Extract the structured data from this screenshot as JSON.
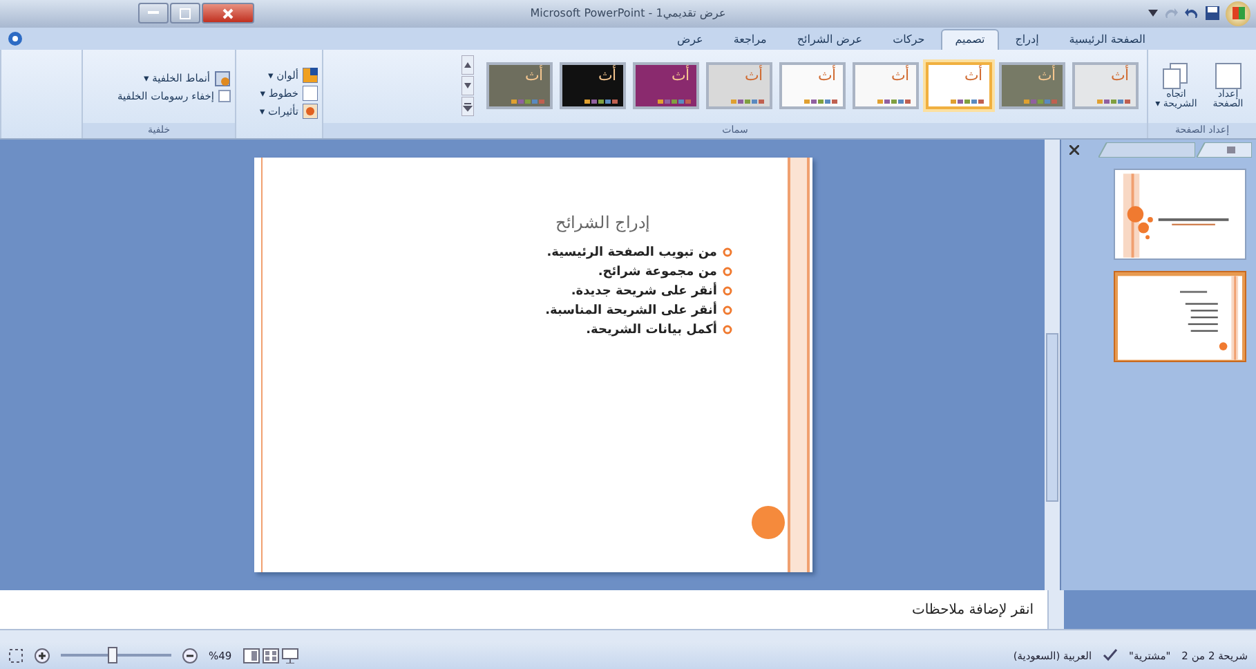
{
  "window": {
    "title": "عرض تقديمي1 - Microsoft PowerPoint"
  },
  "tabs": [
    {
      "label": "الصفحة الرئيسية",
      "selected": false
    },
    {
      "label": "إدراج",
      "selected": false
    },
    {
      "label": "تصميم",
      "selected": true
    },
    {
      "label": "حركات",
      "selected": false
    },
    {
      "label": "عرض الشرائح",
      "selected": false
    },
    {
      "label": "مراجعة",
      "selected": false
    },
    {
      "label": "عرض",
      "selected": false
    }
  ],
  "ribbon": {
    "page_setup": {
      "buttons": [
        "إعداد الصفحة",
        "اتجاه الشريحة ▾"
      ],
      "group_label": "إعداد الصفحة"
    },
    "themes": {
      "items": [
        {
          "sample": "أث",
          "color": "#e4e6e8",
          "selected": false
        },
        {
          "sample": "أث",
          "color": "#777a66",
          "selected": false
        },
        {
          "sample": "أث",
          "color": "#ffffff",
          "selected": true
        },
        {
          "sample": "أث",
          "color": "#f8f8f8",
          "selected": false
        },
        {
          "sample": "أث",
          "color": "#fafafa",
          "selected": false
        },
        {
          "sample": "أث",
          "color": "#d9d9d9",
          "selected": false
        },
        {
          "sample": "أث",
          "color": "#8a2a6e",
          "selected": false
        },
        {
          "sample": "أث",
          "color": "#111111",
          "selected": false
        },
        {
          "sample": "أث",
          "color": "#6e6e5e",
          "selected": false
        }
      ],
      "group_label": "سمات"
    },
    "theme_options": [
      "ألوان ▾",
      "خطوط ▾",
      "تأثيرات ▾"
    ],
    "background": {
      "styles_button": "أنماط الخلفية ▾",
      "hide_graphics": {
        "label": "إخفاء رسومات الخلفية",
        "checked": false
      },
      "group_label": "خلفية"
    }
  },
  "slide": {
    "title": "إدراج الشرائح",
    "bullets": [
      "من تبويب الصفحة الرئيسية.",
      "من مجموعة شرائح.",
      "أنقر على شريحة جديدة.",
      "أنقر على الشريحة المناسبة.",
      "أكمل بيانات الشريحة."
    ]
  },
  "thumbnails": [
    {
      "kind": "title",
      "selected": false
    },
    {
      "kind": "content",
      "selected": true
    }
  ],
  "notes": {
    "placeholder": "انقر لإضافة ملاحظات"
  },
  "status_bar": {
    "slide_count": "شريحة 2 من 2",
    "theme": "\"مشترية\"",
    "language": "العربية (السعودية)",
    "zoom": "%49",
    "zoom_slider": {
      "level": 0.45
    }
  }
}
